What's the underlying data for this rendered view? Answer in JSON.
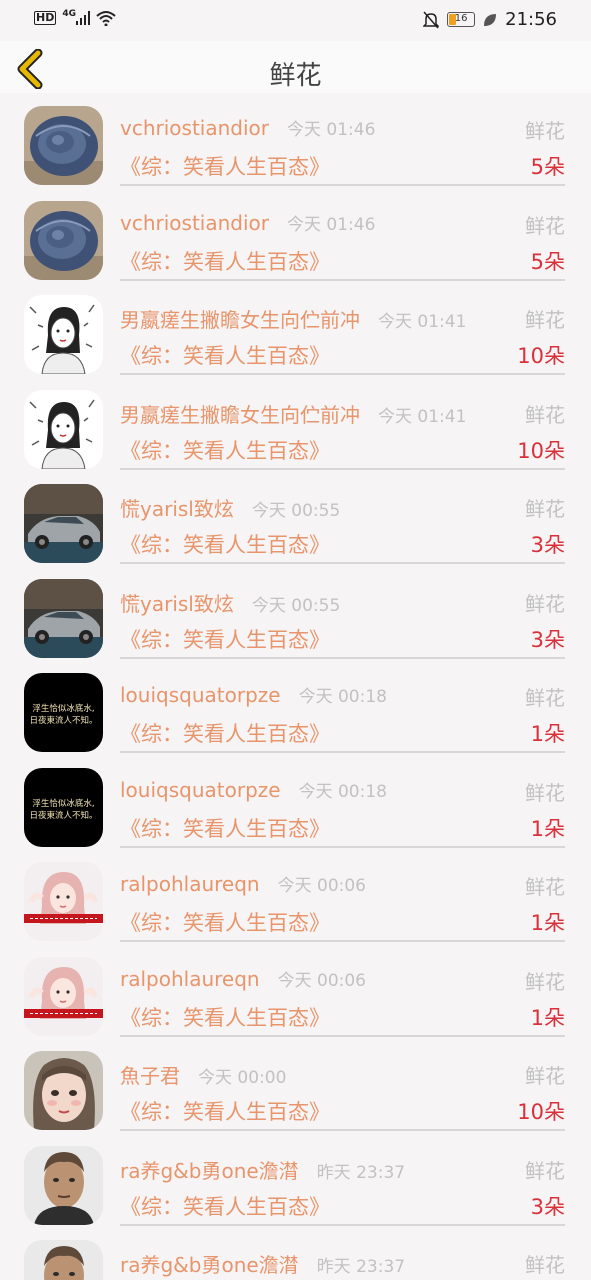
{
  "status_bar": {
    "hd": "HD",
    "network": "4G",
    "battery": "16",
    "time": "21:56"
  },
  "header": {
    "title": "鲜花"
  },
  "icons": {
    "back": "chevron-left-icon",
    "signal": "signal-icon",
    "wifi": "wifi-icon",
    "mute": "bell-off-icon",
    "battery": "battery-icon",
    "leaf": "leaf-icon"
  },
  "colors": {
    "accent": "#e8956b",
    "count": "#d9303a",
    "muted": "#c2c2c2",
    "back_arrow": "#e6b800"
  },
  "items": [
    {
      "name": "vchriostiandior",
      "time": "今天 01:46",
      "type": "鲜花",
      "book": "《综：笑看人生百态》",
      "count": "5朵",
      "avatar": "snail-shell"
    },
    {
      "name": "vchriostiandior",
      "time": "今天 01:46",
      "type": "鲜花",
      "book": "《综：笑看人生百态》",
      "count": "5朵",
      "avatar": "snail-shell"
    },
    {
      "name": "男嬴瘥生撇瞻女生向伫前冲",
      "time": "今天 01:41",
      "type": "鲜花",
      "book": "《综：笑看人生百态》",
      "count": "10朵",
      "avatar": "sketch-girl"
    },
    {
      "name": "男嬴瘥生撇瞻女生向伫前冲",
      "time": "今天 01:41",
      "type": "鲜花",
      "book": "《综：笑看人生百态》",
      "count": "10朵",
      "avatar": "sketch-girl"
    },
    {
      "name": "慌yarisl致炫",
      "time": "今天 00:55",
      "type": "鲜花",
      "book": "《综：笑看人生百态》",
      "count": "3朵",
      "avatar": "silver-car"
    },
    {
      "name": "慌yarisl致炫",
      "time": "今天 00:55",
      "type": "鲜花",
      "book": "《综：笑看人生百态》",
      "count": "3朵",
      "avatar": "silver-car"
    },
    {
      "name": "louiqsquatorpze",
      "time": "今天 00:18",
      "type": "鲜花",
      "book": "《综：笑看人生百态》",
      "count": "1朵",
      "avatar": "black-text",
      "avatar_text": [
        "浮生恰似冰底水,",
        "日夜東流人不知。"
      ]
    },
    {
      "name": "louiqsquatorpze",
      "time": "今天 00:18",
      "type": "鲜花",
      "book": "《综：笑看人生百态》",
      "count": "1朵",
      "avatar": "black-text",
      "avatar_text": [
        "浮生恰似冰底水,",
        "日夜東流人不知。"
      ]
    },
    {
      "name": "ralpohlaureqn",
      "time": "今天 00:06",
      "type": "鲜花",
      "book": "《综：笑看人生百态》",
      "count": "1朵",
      "avatar": "pink-girl"
    },
    {
      "name": "ralpohlaureqn",
      "time": "今天 00:06",
      "type": "鲜花",
      "book": "《综：笑看人生百态》",
      "count": "1朵",
      "avatar": "pink-girl"
    },
    {
      "name": "魚子君",
      "time": "今天 00:00",
      "type": "鲜花",
      "book": "《综：笑看人生百态》",
      "count": "10朵",
      "avatar": "painted-girl"
    },
    {
      "name": "ra养g&b勇one澹潸",
      "time": "昨天 23:37",
      "type": "鲜花",
      "book": "《综：笑看人生百态》",
      "count": "3朵",
      "avatar": "man-portrait"
    },
    {
      "name": "ra养g&b勇one澹潸",
      "time": "昨天 23:37",
      "type": "鲜花",
      "book": "",
      "count": "",
      "avatar": "man-portrait"
    }
  ]
}
